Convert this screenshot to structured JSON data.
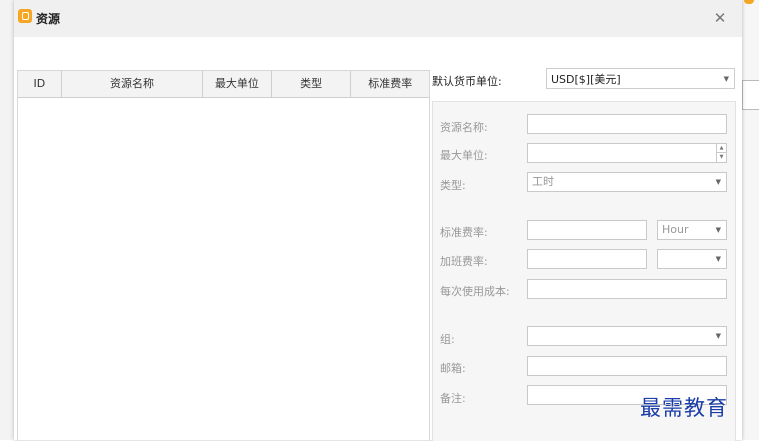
{
  "dialog": {
    "title": "资源",
    "close_icon": "close-icon"
  },
  "table": {
    "columns": [
      "ID",
      "资源名称",
      "最大单位",
      "类型",
      "标准费率"
    ],
    "rows": []
  },
  "currency": {
    "label": "默认货币单位:",
    "value": "USD[$][美元]"
  },
  "form": {
    "name_label": "资源名称:",
    "max_units_label": "最大单位:",
    "type_label": "类型:",
    "type_value": "工时",
    "std_rate_label": "标准费率:",
    "std_rate_unit": "Hour",
    "ot_rate_label": "加班费率:",
    "cost_per_use_label": "每次使用成本:",
    "group_label": "组:",
    "email_label": "邮箱:",
    "notes_label": "备注:"
  },
  "watermark": "最需教育",
  "colors": {
    "brand": "#f5a623",
    "watermark": "#1a3da8"
  }
}
